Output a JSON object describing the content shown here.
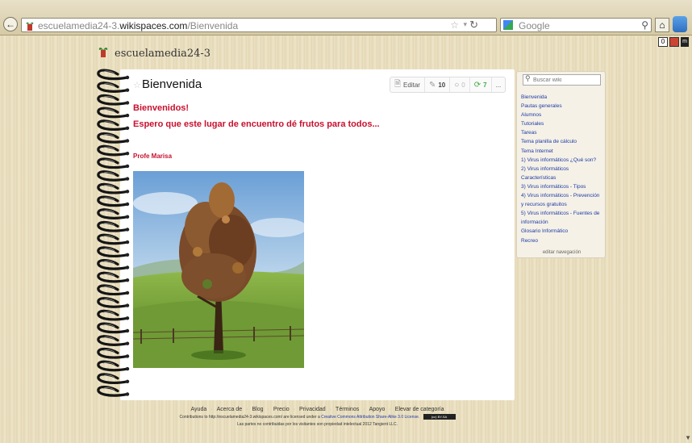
{
  "browser": {
    "url_prefix": "escuelamedia24-3.",
    "url_domain": "wikispaces.com",
    "url_path": "/Bienvenida",
    "search_engine_label": "Google",
    "counter_badge": "0"
  },
  "site": {
    "name": "escuelamedia24-3"
  },
  "page": {
    "title": "Bienvenida",
    "welcome": "Bienvenidos!",
    "message": "Espero que este lugar de encuentro dé frutos para todos...",
    "author": "Profe Marisa"
  },
  "toolbar": {
    "edit_label": "Editar",
    "revisions": "10",
    "comments": "0",
    "follows": "7",
    "more_label": "..."
  },
  "sidebar": {
    "search_placeholder": "Buscar wiki",
    "links": [
      "Bienvenida",
      "Pautas generales",
      "Alumnos",
      "Tutoriales",
      "Tareas",
      "Tema planilla de cálculo",
      "Tema Internet",
      "1) Virus informáticos ¿Qué son?",
      "2) Virus informáticos",
      "Características",
      "3) Virus informáticos - Tipos",
      "4) Virus informáticos - Prevención",
      "y recursos gratuitos",
      "5) Virus informáticos - Fuentes de",
      "información",
      "Glosario Informático",
      "Recreo"
    ],
    "edit_nav_label": "editar navegación"
  },
  "footer": {
    "links": [
      "Ayuda",
      "Acerca de",
      "Blog",
      "Precio",
      "Privacidad",
      "Términos",
      "Apoyo",
      "Elevar de categoría"
    ],
    "license_text": "Contributions to http://escuelamedia24-3.wikispaces.com/ are licensed under a",
    "license_link": "Creative Commons Attribution Share-Alike 3.0 License.",
    "cc_badge": "(cc) BY-SA",
    "ownership_text": "Las partes no contribuidas por los visitantes son propiedad intelectual 2012 Tangient LLC."
  },
  "colors": {
    "accent_red": "#c8102e",
    "link_blue": "#1e3aa8",
    "page_background": "#e8dcbc"
  }
}
